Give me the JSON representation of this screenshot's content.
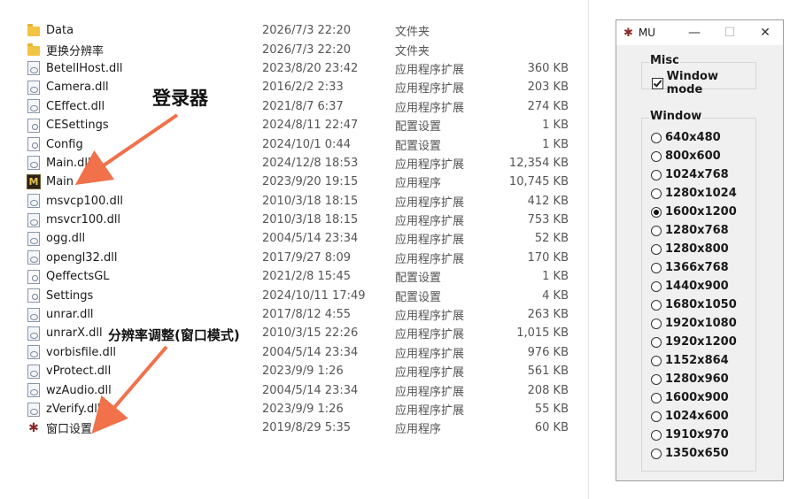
{
  "files": [
    {
      "name": "Data",
      "date": "2026/7/3 22:20",
      "type": "文件夹",
      "size": "",
      "icon": "folder-icon"
    },
    {
      "name": "更换分辨率",
      "date": "2026/7/3 22:20",
      "type": "文件夹",
      "size": "",
      "icon": "folder-icon"
    },
    {
      "name": "BetellHost.dll",
      "date": "2023/8/20 23:42",
      "type": "应用程序扩展",
      "size": "360 KB",
      "icon": "dll-icon"
    },
    {
      "name": "Camera.dll",
      "date": "2016/2/2 2:33",
      "type": "应用程序扩展",
      "size": "203 KB",
      "icon": "dll-icon"
    },
    {
      "name": "CEffect.dll",
      "date": "2021/8/7 6:37",
      "type": "应用程序扩展",
      "size": "274 KB",
      "icon": "dll-icon"
    },
    {
      "name": "CESettings",
      "date": "2024/8/11 22:47",
      "type": "配置设置",
      "size": "1 KB",
      "icon": "config-icon"
    },
    {
      "name": "Config",
      "date": "2024/10/1 0:44",
      "type": "配置设置",
      "size": "1 KB",
      "icon": "config-icon"
    },
    {
      "name": "Main.dll",
      "date": "2024/12/8 18:53",
      "type": "应用程序扩展",
      "size": "12,354 KB",
      "icon": "dll-icon"
    },
    {
      "name": "Main",
      "date": "2023/9/20 19:15",
      "type": "应用程序",
      "size": "10,745 KB",
      "icon": "mu-app-icon"
    },
    {
      "name": "msvcp100.dll",
      "date": "2010/3/18 18:15",
      "type": "应用程序扩展",
      "size": "412 KB",
      "icon": "dll-icon"
    },
    {
      "name": "msvcr100.dll",
      "date": "2010/3/18 18:15",
      "type": "应用程序扩展",
      "size": "753 KB",
      "icon": "dll-icon"
    },
    {
      "name": "ogg.dll",
      "date": "2004/5/14 23:34",
      "type": "应用程序扩展",
      "size": "52 KB",
      "icon": "dll-icon"
    },
    {
      "name": "opengl32.dll",
      "date": "2017/9/27 8:09",
      "type": "应用程序扩展",
      "size": "170 KB",
      "icon": "dll-icon"
    },
    {
      "name": "QeffectsGL",
      "date": "2021/2/8 15:45",
      "type": "配置设置",
      "size": "1 KB",
      "icon": "config-icon"
    },
    {
      "name": "Settings",
      "date": "2024/10/11 17:49",
      "type": "配置设置",
      "size": "4 KB",
      "icon": "config-icon"
    },
    {
      "name": "unrar.dll",
      "date": "2017/8/12 4:55",
      "type": "应用程序扩展",
      "size": "263 KB",
      "icon": "dll-icon"
    },
    {
      "name": "unrarX.dll",
      "date": "2010/3/15 22:26",
      "type": "应用程序扩展",
      "size": "1,015 KB",
      "icon": "dll-icon"
    },
    {
      "name": "vorbisfile.dll",
      "date": "2004/5/14 23:34",
      "type": "应用程序扩展",
      "size": "976 KB",
      "icon": "dll-icon"
    },
    {
      "name": "vProtect.dll",
      "date": "2023/9/9 1:26",
      "type": "应用程序扩展",
      "size": "561 KB",
      "icon": "dll-icon"
    },
    {
      "name": "wzAudio.dll",
      "date": "2004/5/14 23:34",
      "type": "应用程序扩展",
      "size": "208 KB",
      "icon": "dll-icon"
    },
    {
      "name": "zVerify.dll",
      "date": "2023/9/9 1:26",
      "type": "应用程序扩展",
      "size": "55 KB",
      "icon": "dll-icon"
    },
    {
      "name": "窗口设置",
      "date": "2019/8/29 5:35",
      "type": "应用程序",
      "size": "60 KB",
      "icon": "settings-app-icon"
    }
  ],
  "annotations": {
    "launcher": "登录器",
    "resolution": "分辨率调整(窗口模式)"
  },
  "dialog": {
    "title": "MU",
    "minimize": "—",
    "maximize": "☐",
    "close": "✕",
    "misc_title": "Misc",
    "window_mode_label": "Window mode",
    "window_mode_checked": true,
    "window_title": "Window",
    "resolutions": [
      "640x480",
      "800x600",
      "1024x768",
      "1280x1024",
      "1600x1200",
      "1280x768",
      "1280x800",
      "1366x768",
      "1440x900",
      "1680x1050",
      "1920x1080",
      "1920x1200",
      "1152x864",
      "1280x960",
      "1600x900",
      "1024x600",
      "1910x970",
      "1350x650"
    ],
    "selected_resolution": "1600x1200"
  },
  "colors": {
    "arrow": "#f0714a",
    "folder": "#f2c443"
  }
}
